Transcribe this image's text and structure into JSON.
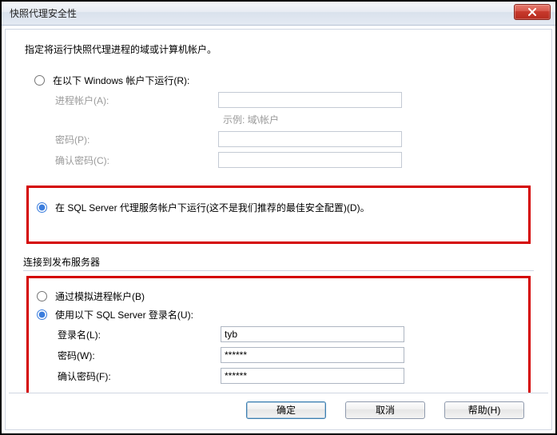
{
  "window": {
    "title": "快照代理安全性"
  },
  "instruction": "指定将运行快照代理进程的域或计算机帐户。",
  "top": {
    "radio_windows": "在以下 Windows 帐户下运行(R):",
    "process_account_label": "进程帐户(A):",
    "process_account_value": "",
    "example": "示例: 域\\帐户",
    "password_label": "密码(P):",
    "password_value": "",
    "confirm_label": "确认密码(C):",
    "confirm_value": "",
    "radio_sqlagent": "在 SQL Server 代理服务帐户下运行(这不是我们推荐的最佳安全配置)(D)。"
  },
  "connect": {
    "section_label": "连接到发布服务器",
    "radio_impersonate": "通过模拟进程帐户(B)",
    "radio_sqllogin": "使用以下 SQL Server 登录名(U):",
    "login_label": "登录名(L):",
    "login_value": "tyb",
    "pwd_label": "密码(W):",
    "pwd_value": "******",
    "confirm_label": "确认密码(F):",
    "confirm_value": "******"
  },
  "buttons": {
    "ok": "确定",
    "cancel": "取消",
    "help": "帮助(H)"
  }
}
